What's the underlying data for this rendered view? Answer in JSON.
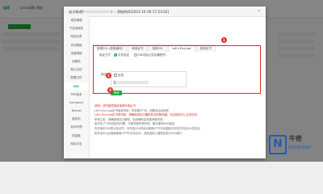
{
  "background": {
    "logo": "宝塔",
    "tabs": [
      "Linux面板",
      "网站"
    ]
  },
  "dialog": {
    "title": "站点修改[",
    "title_suffix": "] -- 添加时间[2022-10-26 17:23:02]"
  },
  "sidebar": [
    {
      "label": "域名管理"
    },
    {
      "label": "子目录绑定"
    },
    {
      "label": "网站目录"
    },
    {
      "label": "访问限制"
    },
    {
      "label": "流量限制"
    },
    {
      "label": "伪静态"
    },
    {
      "label": "默认文档"
    },
    {
      "label": "配置文件"
    },
    {
      "label": "SSL",
      "active": true
    },
    {
      "label": "PHP版本"
    },
    {
      "label": "Composer"
    },
    {
      "label": "Tomcat"
    },
    {
      "label": "重定向"
    },
    {
      "label": "反向代理"
    },
    {
      "label": "防盗链"
    },
    {
      "label": "网站日志"
    }
  ],
  "tabs": [
    {
      "label": "宝塔SSL (英雄通用)"
    },
    {
      "label": "商用证书"
    },
    {
      "label": "宝塔SSL"
    },
    {
      "label": "Let's Encrypt",
      "active": true
    },
    {
      "label": "其他证书"
    }
  ],
  "form": {
    "verify_label": "验证方式",
    "options": [
      {
        "label": "文件验证",
        "selected": true
      },
      {
        "label": "DNS验证(支持通配符)",
        "selected": false
      }
    ],
    "domain_label": "域名",
    "select_all": "全选",
    "apply_button": "申请"
  },
  "markers": [
    "1",
    "2",
    "3"
  ],
  "notes": [
    {
      "text": "说明：请勿随意使用宝塔申请证书",
      "red": true
    },
    {
      "text": "Let's Encrypt证书免费申请，有效期3个月，到期会自动续签",
      "red": false
    },
    {
      "text": "Let's Encrypt证书申请前，请确保域名已解析到当前服务器，并且网站可以正常访问",
      "red": true
    },
    {
      "text": "申请之前，请确保域名已解析，如未解析会导致审核失败",
      "red": false
    },
    {
      "text": "如开启了CDN或反向代理，可能导致申请失败，建议使用DNS验证",
      "red": false
    },
    {
      "text": "在未指定SSL默认站点时，未开启SSL的站点使用HTTPS会直接访问到已开启SSL的站点",
      "red": false
    },
    {
      "text": "如开启SSL后强制使用HTTPS无法访问，请检查防火墙是否放行443端口",
      "red": false
    }
  ],
  "watermark": {
    "letter": "N",
    "title": "牛奇",
    "subtitle": "NIUQI360"
  },
  "colors": {
    "accent": "#20a53a",
    "highlight": "#e52828",
    "brand": "#1c5fb3"
  }
}
